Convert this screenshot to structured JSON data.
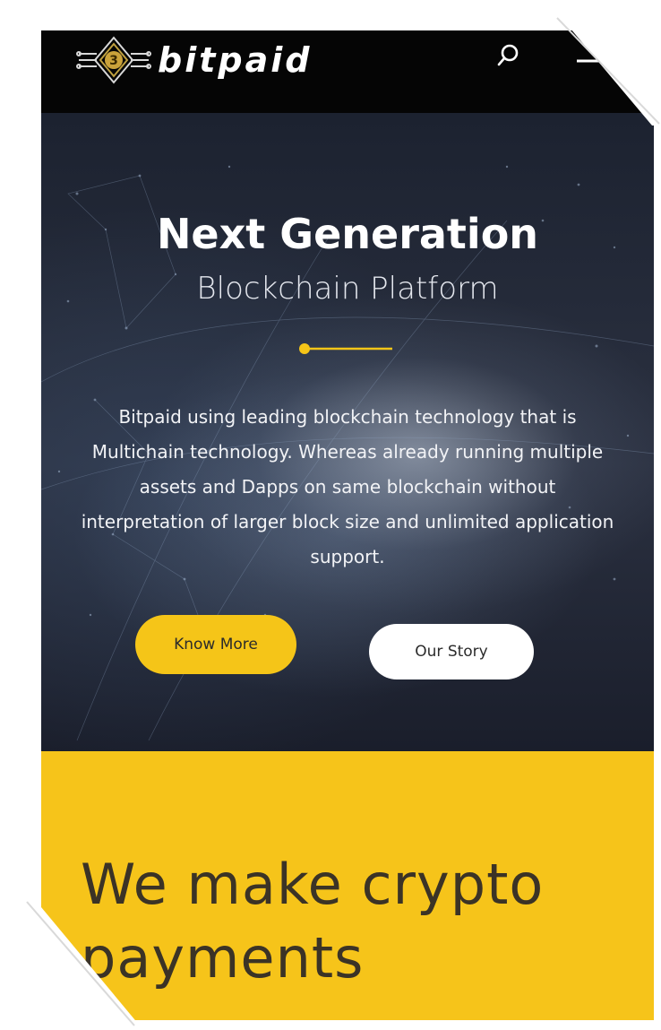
{
  "header": {
    "brand": "bitpaid",
    "logo_icon": "bitpaid-chip-logo",
    "search_icon": "search-icon",
    "menu_icon": "hamburger-menu-icon"
  },
  "hero": {
    "title": "Next Generation",
    "subtitle": "Blockchain Platform",
    "description": "Bitpaid using leading blockchain technology that is Multichain technology. Whereas already running multiple assets and Dapps on same blockchain without interpretation of larger block size and unlimited application support.",
    "primary_button": "Know More",
    "secondary_button": "Our Story"
  },
  "section": {
    "heading": "We make crypto payments"
  },
  "colors": {
    "accent_yellow": "#f6c41a",
    "header_black": "#050505",
    "hero_dark": "#1c2230",
    "heading_dark": "#3b3326"
  }
}
